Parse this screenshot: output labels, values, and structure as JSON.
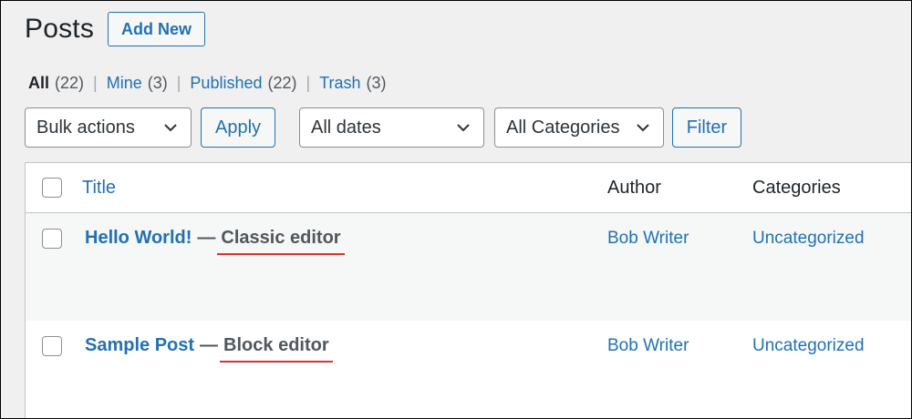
{
  "header": {
    "title": "Posts",
    "add_new_label": "Add New"
  },
  "status_filters": [
    {
      "label": "All",
      "count": "(22)"
    },
    {
      "label": "Mine",
      "count": "(3)"
    },
    {
      "label": "Published",
      "count": "(22)"
    },
    {
      "label": "Trash",
      "count": "(3)"
    }
  ],
  "separator": "|",
  "toolbar": {
    "bulk_actions": "Bulk actions",
    "apply_label": "Apply",
    "dates": "All dates",
    "categories": "All Categories",
    "filter_label": "Filter"
  },
  "table": {
    "columns": {
      "title": "Title",
      "author": "Author",
      "categories": "Categories"
    },
    "rows": [
      {
        "title": "Hello World!",
        "dash": "—",
        "state": "Classic editor",
        "author": "Bob Writer",
        "category": "Uncategorized"
      },
      {
        "title": "Sample Post",
        "dash": "—",
        "state": "Block editor",
        "author": "Bob Writer",
        "category": "Uncategorized"
      }
    ]
  },
  "colors": {
    "link": "#2271b1",
    "annotation_underline": "#d63638"
  }
}
